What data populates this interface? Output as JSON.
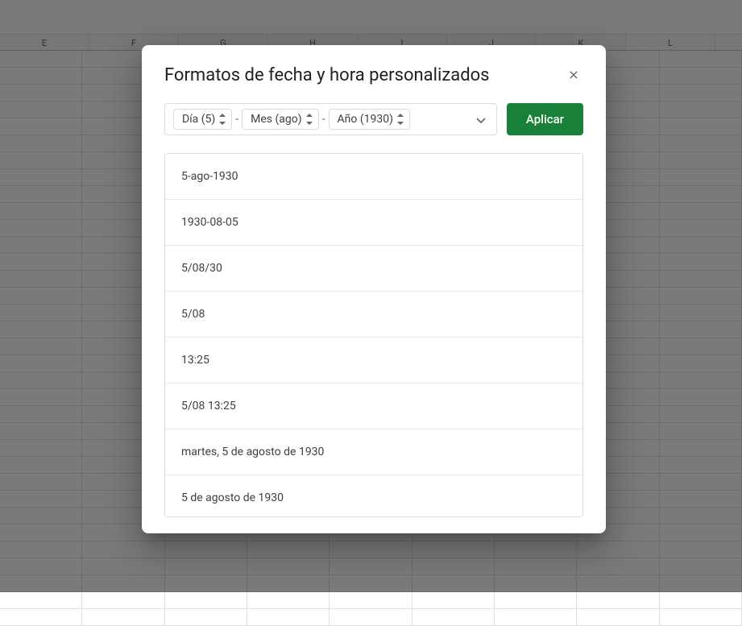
{
  "columns": [
    "E",
    "F",
    "G",
    "H",
    "I",
    "J",
    "K",
    "L"
  ],
  "dialog": {
    "title": "Formatos de fecha y hora personalizados",
    "tokens": {
      "day": "Día (5)",
      "sep1": "-",
      "month": "Mes (ago)",
      "sep2": "-",
      "year": "Año (1930)"
    },
    "apply_label": "Aplicar",
    "formats": [
      "5-ago-1930",
      "1930-08-05",
      "5/08/30",
      "5/08",
      "13:25",
      "5/08 13:25",
      "martes, 5 de agosto de 1930",
      "5 de agosto de 1930"
    ]
  }
}
